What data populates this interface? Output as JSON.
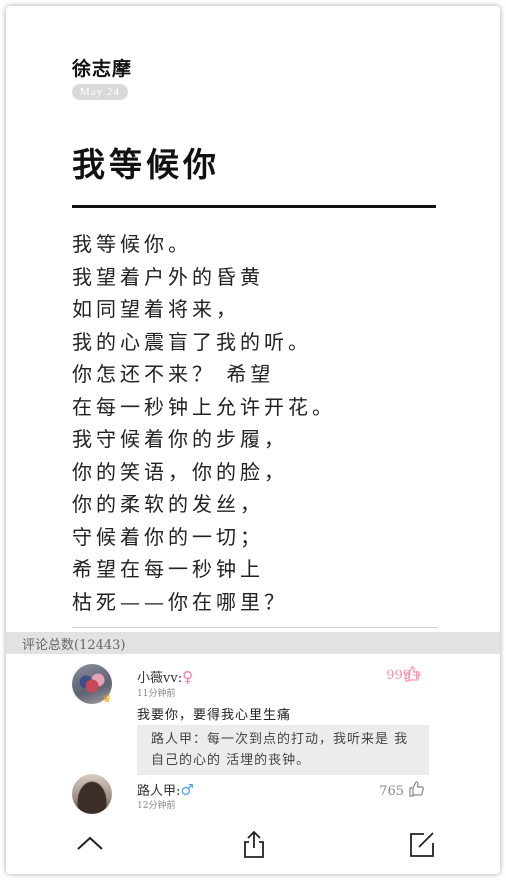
{
  "article": {
    "author": "徐志摩",
    "date": "May 24",
    "title": "我等候你",
    "lines": [
      "我等候你。",
      "我望着户外的昏黄",
      "如同望着将来，",
      "我的心震盲了我的听。",
      "你怎还不来？ 希望",
      "在每一秒钟上允许开花。",
      "我守候着你的步履，",
      "你的笑语，你的脸，",
      "你的柔软的发丝，",
      "守候着你的一切；",
      "希望在每一秒钟上",
      "枯死——你在哪里？"
    ]
  },
  "comments_header": {
    "label": "评论总数(12443)"
  },
  "comments": [
    {
      "name": "小薇vv:",
      "gender_symbol": "♀",
      "time": "11分钟前",
      "likes": "999+",
      "text": "我要你，要得我心里生痛",
      "reply": "路人甲：每一次到点的打动，我听来是 我自己的心的 活埋的丧钟。"
    },
    {
      "name": "路人甲:",
      "gender_symbol": "♂",
      "time": "12分钟前",
      "likes": "765"
    }
  ],
  "toolbar": {
    "icons": [
      "chevron-up-icon",
      "share-icon",
      "edit-icon"
    ]
  },
  "colors": {
    "accent_pink": "#ff8fa8",
    "male_blue": "#4ba3e8",
    "comment_bar": "#e2e2e2"
  }
}
